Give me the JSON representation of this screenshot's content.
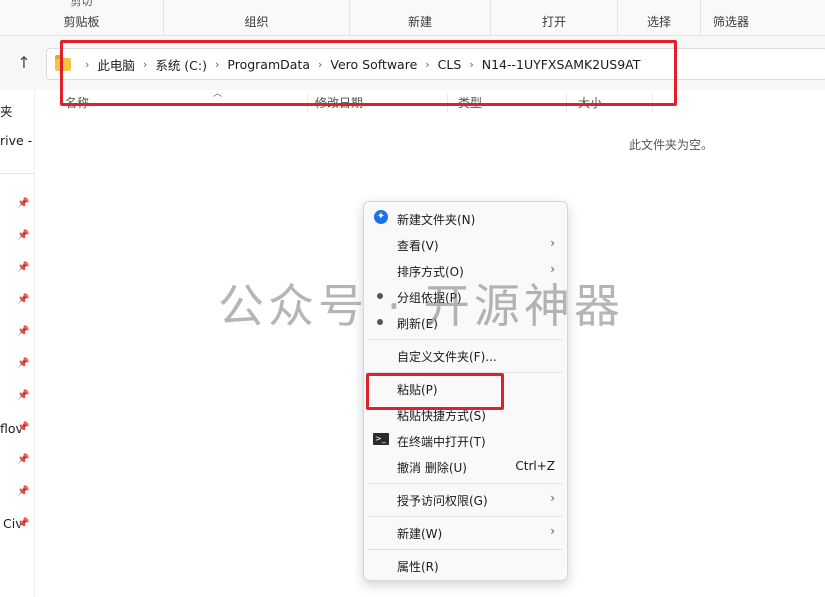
{
  "ribbon": {
    "groups": [
      {
        "caption": "剪贴板",
        "top_text": "剪切"
      },
      {
        "caption": "组织"
      },
      {
        "caption": "新建"
      },
      {
        "caption": "打开"
      },
      {
        "caption": "选择"
      },
      {
        "caption": "筛选器"
      }
    ]
  },
  "address": {
    "crumbs": [
      "此电脑",
      "系统 (C:)",
      "ProgramData",
      "Vero Software",
      "CLS",
      "N14--1UYFXSAMK2US9AT"
    ]
  },
  "sidebar": {
    "items": [
      "夹",
      "rive -",
      "flov",
      "Civ"
    ]
  },
  "columns": {
    "name": "名称",
    "date": "修改日期",
    "type": "类型",
    "size": "大小"
  },
  "empty_message": "此文件夹为空。",
  "watermark": "公众号 · 开源神器",
  "context_menu": {
    "items": [
      {
        "label": "新建文件夹(N)"
      },
      {
        "label": "查看(V)"
      },
      {
        "label": "排序方式(O)"
      },
      {
        "label": "分组依据(P)"
      },
      {
        "label": "刷新(E)"
      },
      {
        "label": "自定义文件夹(F)..."
      },
      {
        "label": "粘贴(P)"
      },
      {
        "label": "粘贴快捷方式(S)"
      },
      {
        "label": "在终端中打开(T)"
      },
      {
        "label": "撤消 删除(U)",
        "shortcut": "Ctrl+Z"
      },
      {
        "label": "授予访问权限(G)"
      },
      {
        "label": "新建(W)"
      },
      {
        "label": "属性(R)"
      }
    ]
  },
  "colors": {
    "highlight": "#e0202a",
    "accent": "#1a73e8"
  }
}
